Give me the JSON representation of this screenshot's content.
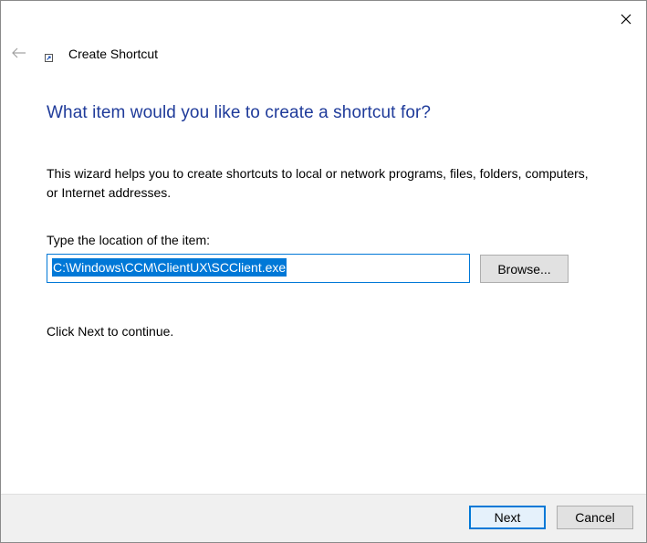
{
  "window": {
    "title": "Create Shortcut"
  },
  "wizard": {
    "heading": "What item would you like to create a shortcut for?",
    "description": "This wizard helps you to create shortcuts to local or network programs, files, folders, computers, or Internet addresses.",
    "location_label": "Type the location of the item:",
    "location_value": "C:\\Windows\\CCM\\ClientUX\\SCClient.exe",
    "browse_label": "Browse...",
    "continue_text": "Click Next to continue."
  },
  "footer": {
    "next_label": "Next",
    "cancel_label": "Cancel"
  },
  "icons": {
    "back": "back-arrow-icon",
    "close": "close-icon",
    "title": "shortcut-icon"
  },
  "colors": {
    "heading": "#1f3b9a",
    "accent": "#0078d7",
    "footer_bg": "#f0f0f0",
    "button_bg": "#e1e1e1"
  }
}
